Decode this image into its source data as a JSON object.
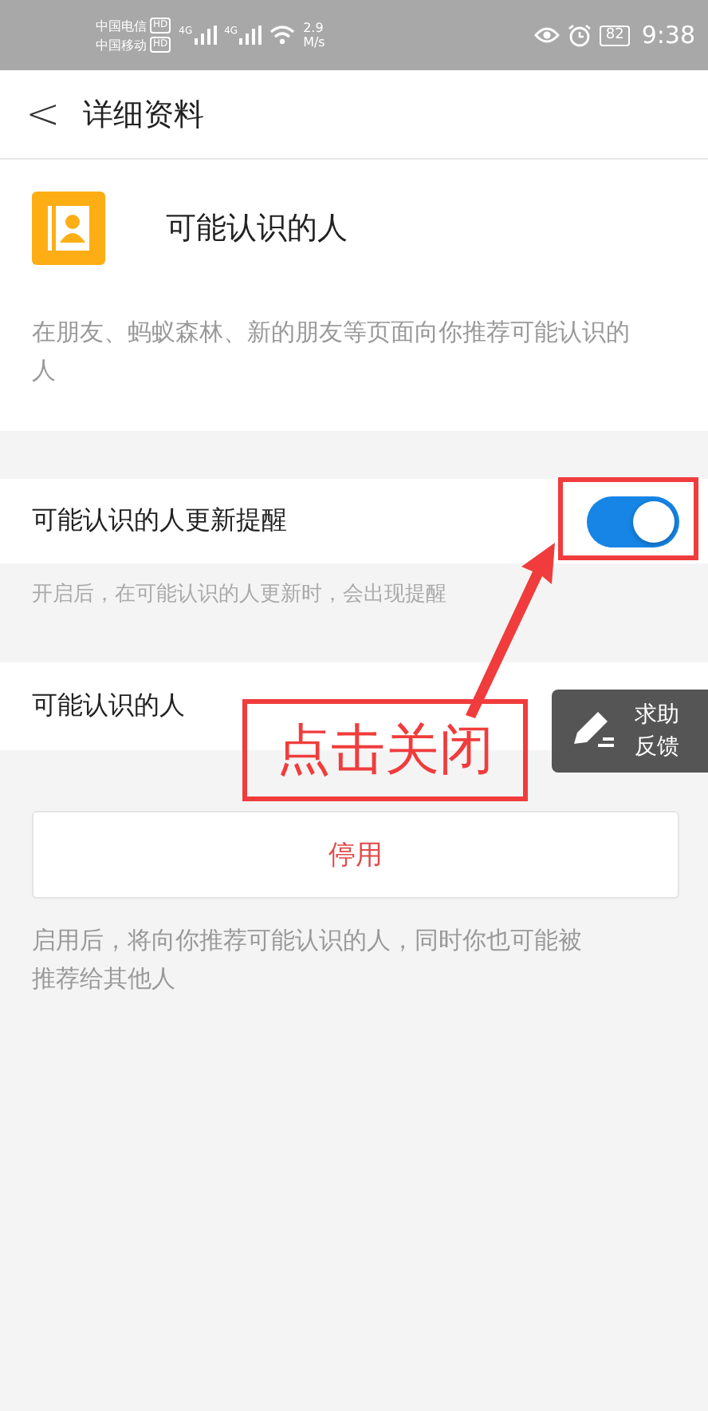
{
  "status_bar": {
    "carriers": [
      {
        "name": "中国电信",
        "badge": "HD"
      },
      {
        "name": "中国移动",
        "badge": "HD"
      }
    ],
    "networks": [
      "4G",
      "4G"
    ],
    "speed": [
      "2.9",
      "M/s"
    ],
    "battery": "82",
    "time": "9:38"
  },
  "header": {
    "back": "<",
    "title": "详细资料"
  },
  "profile": {
    "title": "可能认识的人",
    "description": "在朋友、蚂蚁森林、新的朋友等页面向你推荐可能认识的人"
  },
  "setting": {
    "label": "可能认识的人更新提醒",
    "on": true,
    "hint": "开启后，在可能认识的人更新时，会出现提醒"
  },
  "row": {
    "label": "可能认识的人"
  },
  "disable_button": "停用",
  "footnote": "启用后，将向你推荐可能认识的人，同时你也可能被推荐给其他人",
  "annotation": {
    "text": "点击关闭"
  },
  "feedback": {
    "lines": [
      "求助",
      "反馈"
    ]
  }
}
